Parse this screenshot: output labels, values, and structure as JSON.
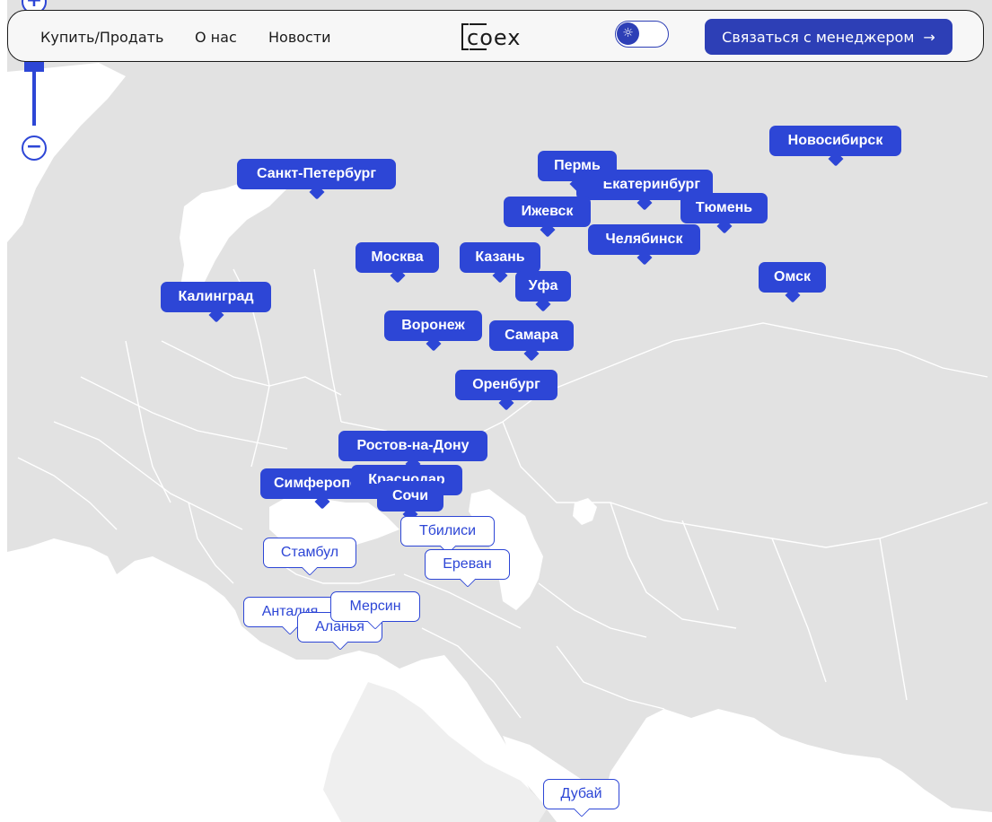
{
  "nav": {
    "buy_sell": "Купить/Продать",
    "about": "О нас",
    "news": "Новости"
  },
  "logo": {
    "text": "coex"
  },
  "theme_toggle": {
    "icon": "sun-icon",
    "state": "light"
  },
  "cta": {
    "label": "Связаться с менеджером",
    "icon": "arrow-right-icon"
  },
  "zoom": {
    "in_icon": "plus-icon",
    "out_icon": "minus-icon"
  },
  "colors": {
    "accent": "#2d46d6",
    "land": "#e2e2e2",
    "land_alt": "#efefef",
    "border": "#ffffff",
    "water": "#ffffff"
  },
  "cities": [
    {
      "id": "novosibirsk",
      "name": "Новосибирск",
      "style": "filled"
    },
    {
      "id": "perm",
      "name": "Пермь",
      "style": "filled"
    },
    {
      "id": "ekaterinburg",
      "name": "Екатеринбург",
      "style": "filled"
    },
    {
      "id": "spb",
      "name": "Санкт-Петербург",
      "style": "filled"
    },
    {
      "id": "izhevsk",
      "name": "Ижевск",
      "style": "filled"
    },
    {
      "id": "tyumen",
      "name": "Тюмень",
      "style": "filled"
    },
    {
      "id": "chelyabinsk",
      "name": "Челябинск",
      "style": "filled"
    },
    {
      "id": "moscow",
      "name": "Москва",
      "style": "filled"
    },
    {
      "id": "kazan",
      "name": "Казань",
      "style": "filled"
    },
    {
      "id": "omsk",
      "name": "Омск",
      "style": "filled"
    },
    {
      "id": "ufa",
      "name": "Уфа",
      "style": "filled"
    },
    {
      "id": "kaliningrad",
      "name": "Калинград",
      "style": "filled"
    },
    {
      "id": "voronezh",
      "name": "Воронеж",
      "style": "filled"
    },
    {
      "id": "samara",
      "name": "Самара",
      "style": "filled"
    },
    {
      "id": "orenburg",
      "name": "Оренбург",
      "style": "filled"
    },
    {
      "id": "rostov",
      "name": "Ростов-на-Дону",
      "style": "filled"
    },
    {
      "id": "simferopol",
      "name": "Симферополь",
      "style": "filled"
    },
    {
      "id": "krasnodar",
      "name": "Краснодар",
      "style": "filled"
    },
    {
      "id": "sochi",
      "name": "Сочи",
      "style": "filled"
    },
    {
      "id": "tbilisi",
      "name": "Тбилиси",
      "style": "outline"
    },
    {
      "id": "istanbul",
      "name": "Стамбул",
      "style": "outline"
    },
    {
      "id": "yerevan",
      "name": "Ереван",
      "style": "outline"
    },
    {
      "id": "antalya",
      "name": "Анталия",
      "style": "outline"
    },
    {
      "id": "mersin",
      "name": "Мерсин",
      "style": "outline"
    },
    {
      "id": "alanya",
      "name": "Аланья",
      "style": "outline"
    },
    {
      "id": "dubai",
      "name": "Дубай",
      "style": "outline"
    }
  ]
}
